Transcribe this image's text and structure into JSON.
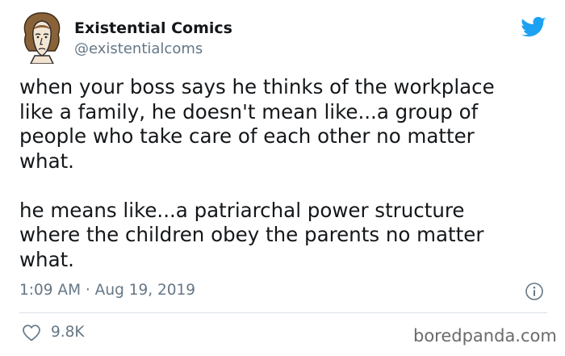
{
  "author": {
    "display_name": "Existential Comics",
    "handle": "@existentialcoms"
  },
  "tweet": {
    "paragraph_1": "when your boss says he thinks of the workplace\nlike a family, he doesn't mean like...a group of\npeople who take care of each other no matter\nwhat.",
    "paragraph_2": "he means like...a patriarchal power structure\nwhere the children obey the parents no matter\nwhat.",
    "timestamp": "1:09 AM · Aug 19, 2019",
    "likes": "9.8K"
  },
  "watermark": "boredpanda.com",
  "icons": {
    "brand": "twitter-bird-icon",
    "info": "info-icon",
    "like": "heart-icon"
  },
  "colors": {
    "twitter_blue": "#1da1f2",
    "secondary_text": "#657786",
    "primary_text": "#14171a"
  }
}
